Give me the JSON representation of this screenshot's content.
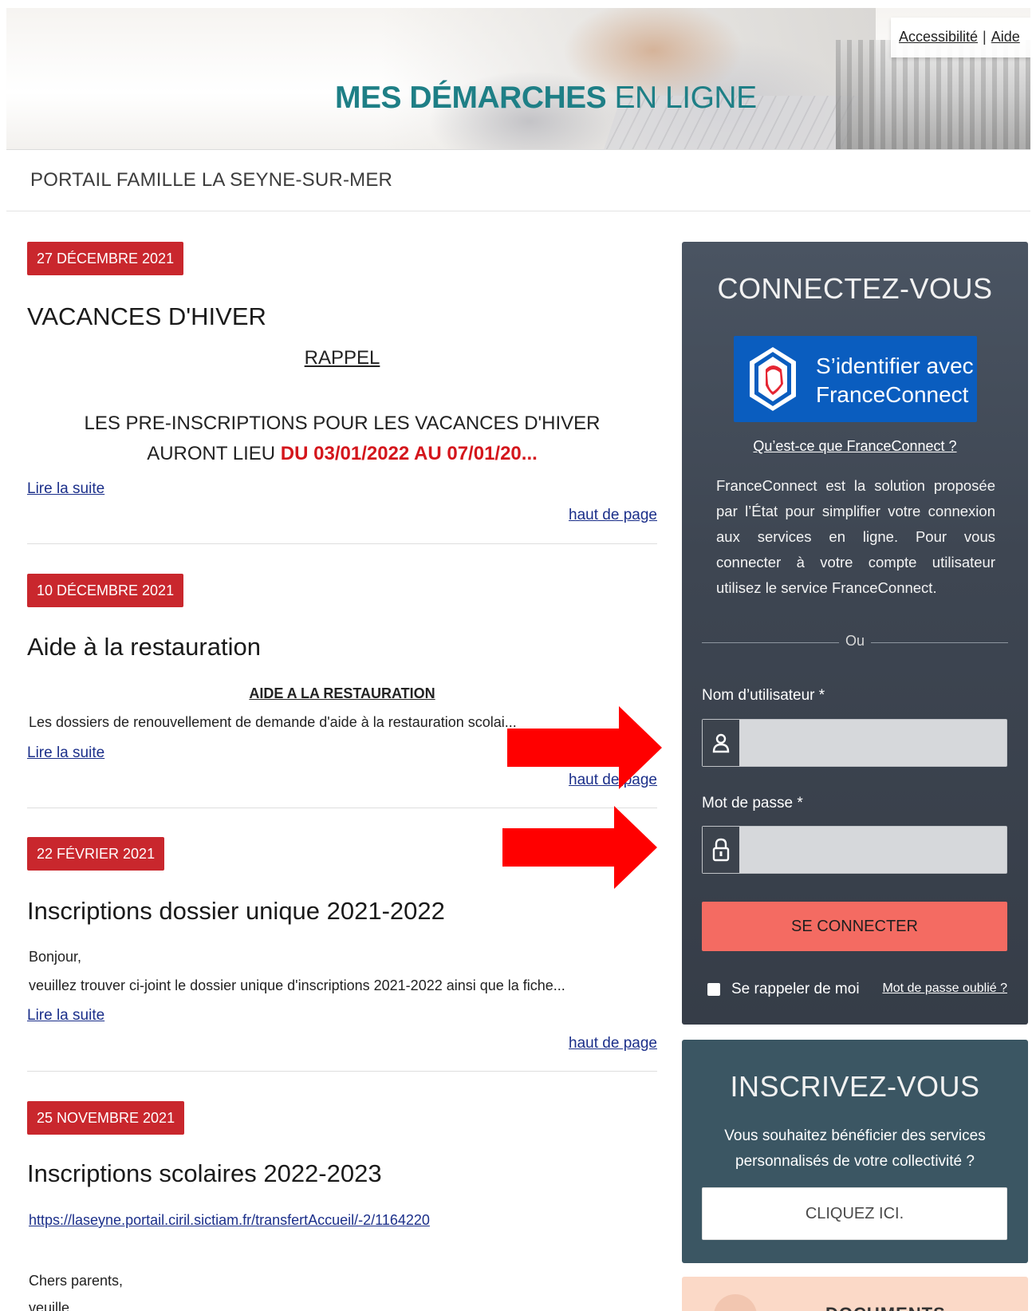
{
  "header": {
    "title_strong": "MES DÉMARCHES",
    "title_light": "EN LIGNE",
    "nav": [
      {
        "label": "Accessibilité"
      },
      {
        "label": "Aide"
      }
    ],
    "nav_separator": "|"
  },
  "portal_title": "PORTAIL FAMILLE LA SEYNE-SUR-MER",
  "news": [
    {
      "date": "27 DÉCEMBRE 2021",
      "title": "VACANCES D'HIVER",
      "subtitle": "RAPPEL",
      "line1": "LES PRE-INSCRIPTIONS POUR LES VACANCES D'HIVER",
      "line2_prefix": "AURONT LIEU ",
      "line2_highlight": "DU 03/01/2022 AU 07/01/20...",
      "read_more": "Lire la suite",
      "top_link": "haut de page"
    },
    {
      "date": "10 DÉCEMBRE 2021",
      "title": "Aide à la restauration",
      "subtitle": "AIDE A LA RESTAURATION",
      "excerpt": "Les dossiers de renouvellement de demande d'aide à la restauration scolai...",
      "read_more": "Lire la suite",
      "top_link": "haut de page"
    },
    {
      "date": "22 FÉVRIER 2021",
      "title": "Inscriptions dossier unique 2021-2022",
      "excerpt_line1": "Bonjour,",
      "excerpt_line2": "veuillez trouver ci-joint le dossier unique d'inscriptions 2021-2022 ainsi que la fiche...",
      "read_more": "Lire la suite",
      "top_link": "haut de page"
    },
    {
      "date": "25 NOVEMBRE 2021",
      "title": "Inscriptions scolaires 2022-2023",
      "url": "https://laseyne.portail.ciril.sictiam.fr/transfertAccueil/-2/1164220",
      "excerpt_line1": "Chers parents,",
      "excerpt_line2": "veuille..."
    }
  ],
  "login": {
    "title": "CONNECTEZ-VOUS",
    "franceconnect_line1": "S’identifier avec",
    "franceconnect_line2": "FranceConnect",
    "what_is": "Qu’est-ce que FranceConnect ?",
    "description": "FranceConnect est la solution proposée par l’État pour simplifier votre connexion aux services en ligne. Pour vous connecter à votre compte utilisateur utilisez le service FranceConnect.",
    "or": "Ou",
    "username_label": "Nom d’utilisateur *",
    "username_value": "",
    "password_label": "Mot de passe *",
    "password_value": "",
    "submit": "SE CONNECTER",
    "remember": "Se rappeler de moi",
    "forgot": "Mot de passe oublié ?"
  },
  "register": {
    "title": "INSCRIVEZ-VOUS",
    "description": "Vous souhaitez bénéficier des services personnalisés de votre collectivité ?",
    "button": "CLIQUEZ ICI."
  },
  "documents": {
    "title": "DOCUMENTS"
  },
  "colors": {
    "brand_teal": "#1e7f86",
    "date_badge": "#c9272d",
    "login_panel": "#3e4652",
    "connect_button": "#f46b62",
    "register_panel": "#3b5663",
    "franceconnect_blue": "#0a5dbf",
    "annotation_arrow": "#ff0000"
  },
  "icons": {
    "username": "user-icon",
    "password": "lock-icon",
    "annotation": "red-arrow-icon"
  }
}
